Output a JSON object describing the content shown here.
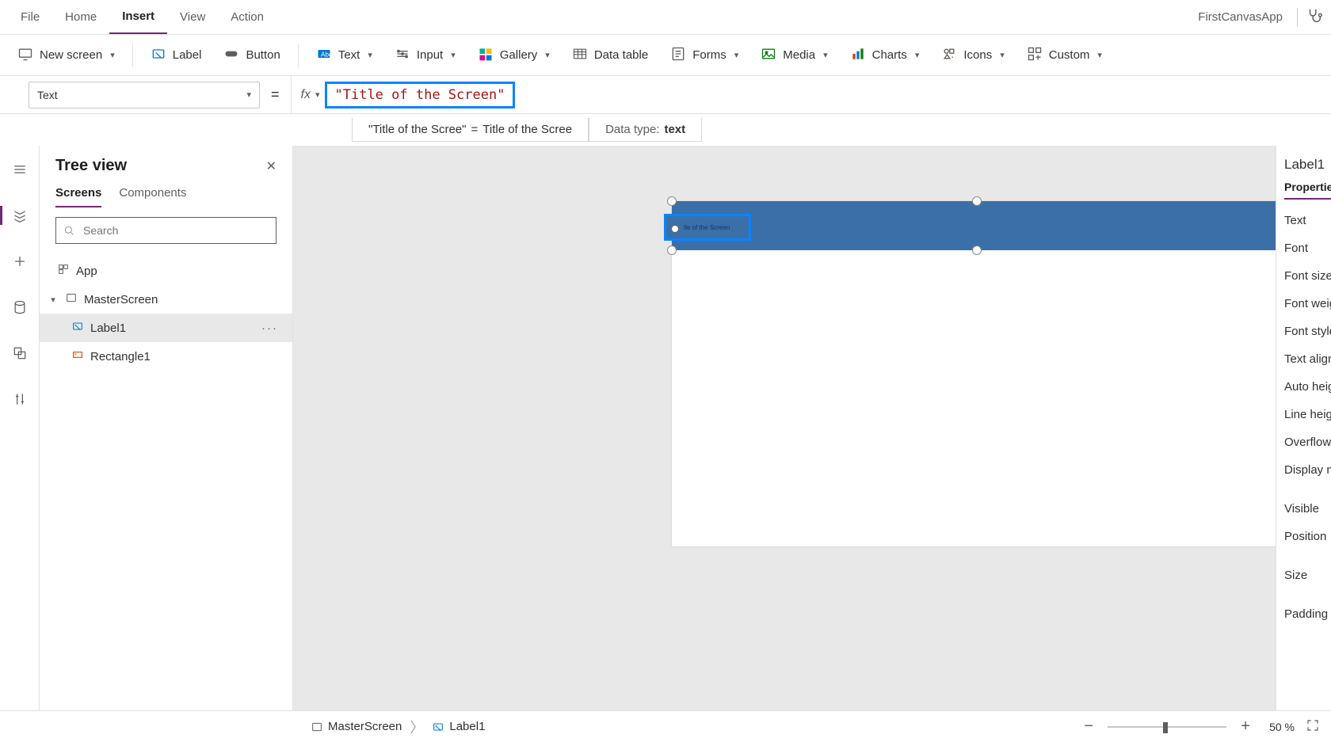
{
  "menubar": {
    "items": [
      "File",
      "Home",
      "Insert",
      "View",
      "Action"
    ],
    "active_index": 2,
    "app_name": "FirstCanvasApp"
  },
  "ribbon": {
    "new_screen": "New screen",
    "label": "Label",
    "button": "Button",
    "text": "Text",
    "input": "Input",
    "gallery": "Gallery",
    "data_table": "Data table",
    "forms": "Forms",
    "media": "Media",
    "charts": "Charts",
    "icons": "Icons",
    "custom": "Custom"
  },
  "formula": {
    "property": "Text",
    "fx": "fx",
    "value": "\"Title of the Screen\""
  },
  "result": {
    "lhs": "\"Title of the Scree\"",
    "eq": "=",
    "rhs": "Title of the Scree",
    "dtlabel": "Data type:",
    "dtvalue": "text"
  },
  "tree": {
    "title": "Tree view",
    "tabs": [
      "Screens",
      "Components"
    ],
    "active_tab": 0,
    "search_placeholder": "Search",
    "app": "App",
    "nodes": {
      "screen": "MasterScreen",
      "label": "Label1",
      "rect": "Rectangle1"
    }
  },
  "canvas": {
    "label_text": "tle of the Screen"
  },
  "props": {
    "title": "Label1",
    "tab": "Properties",
    "items": [
      "Text",
      "Font",
      "Font size",
      "Font weight",
      "Font style",
      "Text alignm",
      "Auto height",
      "Line height",
      "Overflow",
      "Display mo",
      "Visible",
      "Position",
      "Size",
      "Padding"
    ]
  },
  "status": {
    "crumb1": "MasterScreen",
    "crumb2": "Label1",
    "zoom_value": "50",
    "zoom_pct": "%"
  }
}
